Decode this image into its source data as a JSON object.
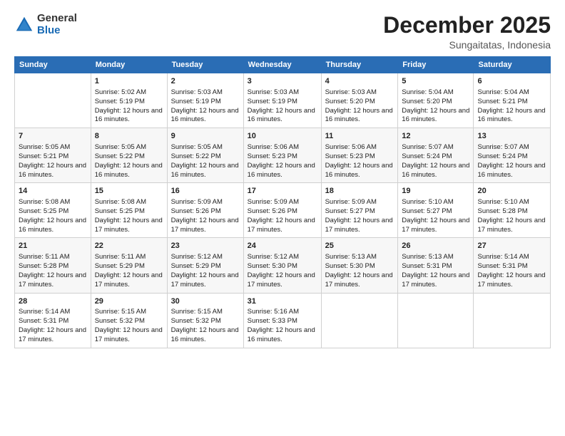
{
  "logo": {
    "general": "General",
    "blue": "Blue"
  },
  "title": "December 2025",
  "subtitle": "Sungaitatas, Indonesia",
  "days_of_week": [
    "Sunday",
    "Monday",
    "Tuesday",
    "Wednesday",
    "Thursday",
    "Friday",
    "Saturday"
  ],
  "weeks": [
    [
      {
        "day": "",
        "info": ""
      },
      {
        "day": "1",
        "info": "Sunrise: 5:02 AM\nSunset: 5:19 PM\nDaylight: 12 hours and 16 minutes."
      },
      {
        "day": "2",
        "info": "Sunrise: 5:03 AM\nSunset: 5:19 PM\nDaylight: 12 hours and 16 minutes."
      },
      {
        "day": "3",
        "info": "Sunrise: 5:03 AM\nSunset: 5:19 PM\nDaylight: 12 hours and 16 minutes."
      },
      {
        "day": "4",
        "info": "Sunrise: 5:03 AM\nSunset: 5:20 PM\nDaylight: 12 hours and 16 minutes."
      },
      {
        "day": "5",
        "info": "Sunrise: 5:04 AM\nSunset: 5:20 PM\nDaylight: 12 hours and 16 minutes."
      },
      {
        "day": "6",
        "info": "Sunrise: 5:04 AM\nSunset: 5:21 PM\nDaylight: 12 hours and 16 minutes."
      }
    ],
    [
      {
        "day": "7",
        "info": ""
      },
      {
        "day": "8",
        "info": "Sunrise: 5:05 AM\nSunset: 5:22 PM\nDaylight: 12 hours and 16 minutes."
      },
      {
        "day": "9",
        "info": "Sunrise: 5:05 AM\nSunset: 5:22 PM\nDaylight: 12 hours and 16 minutes."
      },
      {
        "day": "10",
        "info": "Sunrise: 5:06 AM\nSunset: 5:23 PM\nDaylight: 12 hours and 16 minutes."
      },
      {
        "day": "11",
        "info": "Sunrise: 5:06 AM\nSunset: 5:23 PM\nDaylight: 12 hours and 16 minutes."
      },
      {
        "day": "12",
        "info": "Sunrise: 5:07 AM\nSunset: 5:24 PM\nDaylight: 12 hours and 16 minutes."
      },
      {
        "day": "13",
        "info": "Sunrise: 5:07 AM\nSunset: 5:24 PM\nDaylight: 12 hours and 16 minutes."
      }
    ],
    [
      {
        "day": "14",
        "info": ""
      },
      {
        "day": "15",
        "info": "Sunrise: 5:08 AM\nSunset: 5:25 PM\nDaylight: 12 hours and 17 minutes."
      },
      {
        "day": "16",
        "info": "Sunrise: 5:09 AM\nSunset: 5:26 PM\nDaylight: 12 hours and 17 minutes."
      },
      {
        "day": "17",
        "info": "Sunrise: 5:09 AM\nSunset: 5:26 PM\nDaylight: 12 hours and 17 minutes."
      },
      {
        "day": "18",
        "info": "Sunrise: 5:09 AM\nSunset: 5:27 PM\nDaylight: 12 hours and 17 minutes."
      },
      {
        "day": "19",
        "info": "Sunrise: 5:10 AM\nSunset: 5:27 PM\nDaylight: 12 hours and 17 minutes."
      },
      {
        "day": "20",
        "info": "Sunrise: 5:10 AM\nSunset: 5:28 PM\nDaylight: 12 hours and 17 minutes."
      }
    ],
    [
      {
        "day": "21",
        "info": ""
      },
      {
        "day": "22",
        "info": "Sunrise: 5:11 AM\nSunset: 5:29 PM\nDaylight: 12 hours and 17 minutes."
      },
      {
        "day": "23",
        "info": "Sunrise: 5:12 AM\nSunset: 5:29 PM\nDaylight: 12 hours and 17 minutes."
      },
      {
        "day": "24",
        "info": "Sunrise: 5:12 AM\nSunset: 5:30 PM\nDaylight: 12 hours and 17 minutes."
      },
      {
        "day": "25",
        "info": "Sunrise: 5:13 AM\nSunset: 5:30 PM\nDaylight: 12 hours and 17 minutes."
      },
      {
        "day": "26",
        "info": "Sunrise: 5:13 AM\nSunset: 5:31 PM\nDaylight: 12 hours and 17 minutes."
      },
      {
        "day": "27",
        "info": "Sunrise: 5:14 AM\nSunset: 5:31 PM\nDaylight: 12 hours and 17 minutes."
      }
    ],
    [
      {
        "day": "28",
        "info": "Sunrise: 5:14 AM\nSunset: 5:31 PM\nDaylight: 12 hours and 17 minutes."
      },
      {
        "day": "29",
        "info": "Sunrise: 5:15 AM\nSunset: 5:32 PM\nDaylight: 12 hours and 17 minutes."
      },
      {
        "day": "30",
        "info": "Sunrise: 5:15 AM\nSunset: 5:32 PM\nDaylight: 12 hours and 16 minutes."
      },
      {
        "day": "31",
        "info": "Sunrise: 5:16 AM\nSunset: 5:33 PM\nDaylight: 12 hours and 16 minutes."
      },
      {
        "day": "",
        "info": ""
      },
      {
        "day": "",
        "info": ""
      },
      {
        "day": "",
        "info": ""
      }
    ]
  ],
  "week1_day7_info": "Sunrise: 5:05 AM\nSunset: 5:21 PM\nDaylight: 12 hours and 16 minutes.",
  "week2_day14_info": "Sunrise: 5:08 AM\nSunset: 5:25 PM\nDaylight: 12 hours and 16 minutes.",
  "week3_day21_info": "Sunrise: 5:11 AM\nSunset: 5:28 PM\nDaylight: 12 hours and 17 minutes."
}
